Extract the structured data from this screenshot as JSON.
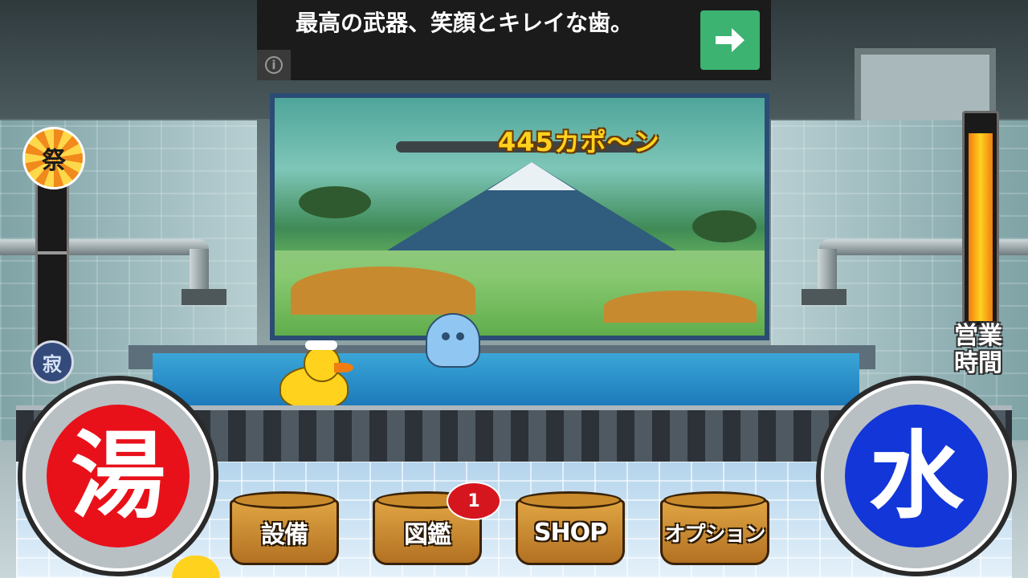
{
  "ad": {
    "text": "最高の武器、笑顔とキレイな歯。",
    "info_icon": "info-icon",
    "arrow_icon": "arrow-right-icon",
    "button_color": "#3cb371"
  },
  "score": {
    "value_text": "445カポ〜ン"
  },
  "gauges": {
    "festival_label": "祭",
    "quiet_label": "寂",
    "business_hours_label": "営業時間",
    "business_hours_level": 0.92
  },
  "valves": {
    "hot_label": "湯",
    "cold_label": "水",
    "hot_color": "#e8111a",
    "cold_color": "#1236d8"
  },
  "menu": {
    "items": [
      {
        "label": "設備"
      },
      {
        "label": "図鑑",
        "badge": "1"
      },
      {
        "label": "SHOP"
      },
      {
        "label": "オプション"
      }
    ]
  }
}
